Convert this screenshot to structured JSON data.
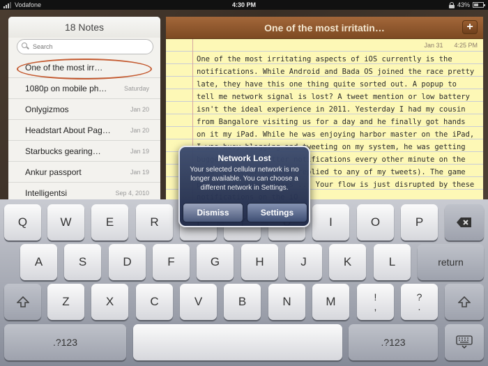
{
  "statusbar": {
    "carrier": "Vodafone",
    "time": "4:30 PM",
    "battery": "43%",
    "battery_level": 0.43
  },
  "notes_list": {
    "title": "18 Notes",
    "search_placeholder": "Search",
    "items": [
      {
        "title": "One of the most irr…",
        "date": ""
      },
      {
        "title": "1080p on mobile ph…",
        "date": "Saturday"
      },
      {
        "title": "Onlygizmos",
        "date": "Jan 20"
      },
      {
        "title": "Headstart About Pag…",
        "date": "Jan 20"
      },
      {
        "title": "Starbucks gearing…",
        "date": "Jan 19"
      },
      {
        "title": "Ankur passport",
        "date": "Jan 19"
      },
      {
        "title": "Intelligentsi",
        "date": "Sep 4, 2010"
      }
    ]
  },
  "editor": {
    "title": "One of the most irritatin…",
    "add_label": "+",
    "date": "Jan 31",
    "time": "4:25 PM",
    "body": "One of the most irritating aspects of iOS currently is the notifications. While Android and Bada OS joined the race pretty late, they have this one thing quite sorted out. A popup to tell me network signal is lost? A tweet mention or low battery isn't the ideal experience in 2011. Yesterday I had my cousin from Bangalore visiting us for a day and he finally got hands on it my iPad. While he was enjoying harbor master on the iPad, I was busy blogging and tweeting on my system, he was getting bugged by the twitter notifications every other minute on the iPad (whenever someone replied to any of my tweets). The game pauses, a video pauses ... Your flow is just disrupted by these notifications on the iO"
  },
  "alert": {
    "title": "Network Lost",
    "message": "Your selected cellular network is no longer available. You can choose a different network in Settings.",
    "dismiss_label": "Dismiss",
    "settings_label": "Settings"
  },
  "keyboard": {
    "row1": [
      "Q",
      "W",
      "E",
      "R",
      "T",
      "Y",
      "U",
      "I",
      "O",
      "P"
    ],
    "row2": [
      "A",
      "S",
      "D",
      "F",
      "G",
      "H",
      "J",
      "K",
      "L"
    ],
    "row3": [
      "Z",
      "X",
      "C",
      "V",
      "B",
      "N",
      "M"
    ],
    "backspace_icon": "backspace-icon",
    "return_label": "return",
    "shift_icon": "shift-icon",
    "exclaim_top": "!",
    "exclaim_bottom": ",",
    "question_top": "?",
    "question_bottom": ".",
    "numbers_label": ".?123",
    "hide_icon": "keyboard-hide-icon"
  }
}
